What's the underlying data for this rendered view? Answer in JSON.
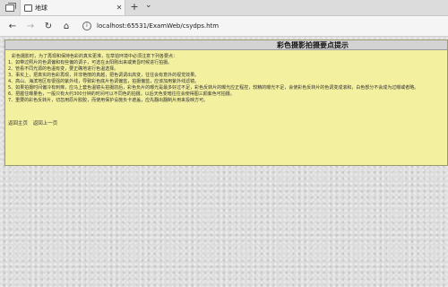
{
  "browser": {
    "tab_title": "地球",
    "url": "localhost:65531/ExamWeb/csydps.htm"
  },
  "page": {
    "title": "彩色摄影拍摄要点提示",
    "intro": "彩色摄影时，为了再现和保持色彩的真实更准，在草拍环境中必须注意下列各要点：",
    "tips": [
      "1、如带过照片的色调偏和有些偏的调子，可选在太阳刚出来或黄昏时候进行拍摄。",
      "2、管看不同光源的色温有变，要正确地进行色温选择。",
      "3、事实上，把真实的色彩再现，并非艳丽的真越，把色调调出高变，往往会有意外的视觉效果。",
      "4、高山、海滨地区有很强的紫外线，导致彩色底片色调偏蓝，拍摄偏蓝，应该加用紫外线滤镜。",
      "5、如果拍摄时间偏冷有刺痒，应马上套色温镜头拍摄前后，彩色负片的曝光是最多好过不足，彩色反转片的曝光应正程控，较精的曝光不足，会使彩色反转片的色调变成滚和，白色部分不会成为过曝或者略。",
      "6、把握住曝量色，一般只有大约300分钟的时间可以不同色的拍摄，以后天色变暗往往会使得图三颜紫色可拍摄。",
      "7、重要的彩色反转片，切忽用原片胶胶，而使用保护设施负卡遮盖，应先翻出翻制片用来投映方可。"
    ],
    "links": {
      "home": "返回主页",
      "back": "返回上一页"
    }
  }
}
